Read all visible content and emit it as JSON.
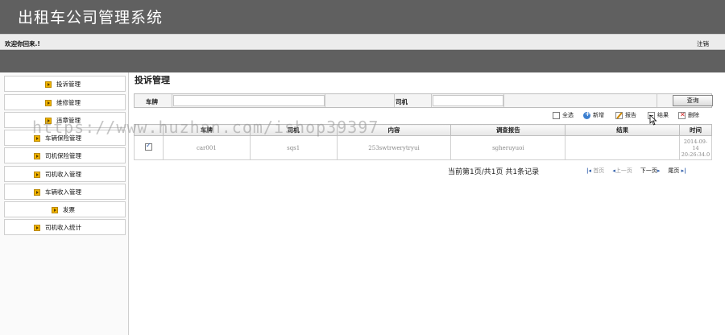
{
  "header": {
    "title": "出租车公司管理系统"
  },
  "welcome_bar": {
    "welcome_text": "欢迎你回来.!",
    "logout_label": "注销"
  },
  "sidebar": {
    "items": [
      {
        "label": "投诉管理",
        "icon": "arrow-right-icon"
      },
      {
        "label": "维修管理",
        "icon": "arrow-right-icon"
      },
      {
        "label": "违章管理",
        "icon": "arrow-right-icon"
      },
      {
        "label": "车辆保险管理",
        "icon": "arrow-right-icon"
      },
      {
        "label": "司机保险管理",
        "icon": "arrow-right-icon"
      },
      {
        "label": "司机收入管理",
        "icon": "arrow-right-icon"
      },
      {
        "label": "车辆收入管理",
        "icon": "arrow-right-icon"
      },
      {
        "label": "发票",
        "icon": "arrow-right-icon"
      },
      {
        "label": "司机收入统计",
        "icon": "arrow-right-icon"
      }
    ]
  },
  "main": {
    "page_title": "投诉管理",
    "search": {
      "plate_label": "车牌",
      "plate_value": "",
      "driver_label": "司机",
      "driver_value": "",
      "query_label": "查询"
    },
    "toolbar": {
      "select_all": "全选",
      "add": "新增",
      "report": "报告",
      "result": "结果",
      "delete": "删除"
    },
    "table": {
      "columns": [
        "",
        "车牌",
        "司机",
        "内容",
        "调查报告",
        "结果",
        "时间"
      ],
      "rows": [
        {
          "checked": true,
          "plate": "car001",
          "driver": "sqs1",
          "content": "253swtrwerytryui",
          "report": "sgheruyuoi",
          "result": "",
          "time_line1": "2014-09-",
          "time_line2": "14",
          "time_line3": "20:26:34.0"
        }
      ]
    },
    "pager": {
      "info": "当前第1页/共1页  共1条记录",
      "first": "首页",
      "prev": "上一页",
      "next": "下一页",
      "last": "尾页"
    }
  },
  "watermark": "https://www.huzhan.com/ishop39397",
  "colors": {
    "header_bg": "#606060",
    "accent_icon": "#f0b400",
    "link_arrow": "#2a5aa8"
  }
}
